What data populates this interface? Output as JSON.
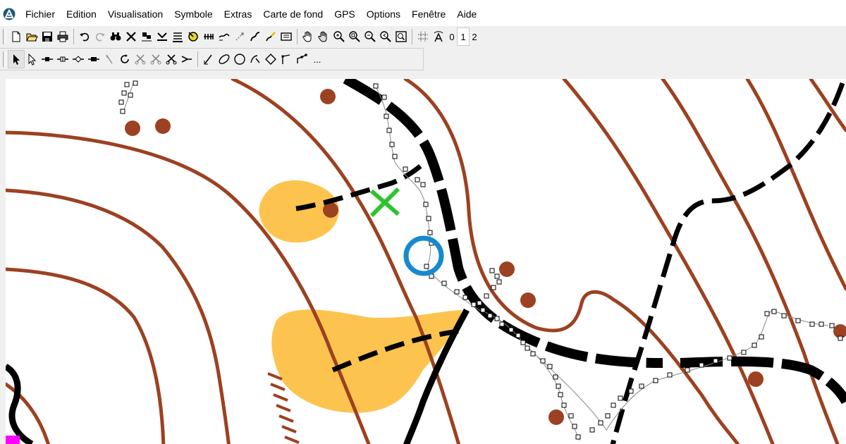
{
  "menu": {
    "items": [
      "Fichier",
      "Edition",
      "Visualisation",
      "Symbole",
      "Extras",
      "Carte de fond",
      "GPS",
      "Options",
      "Fenêtre",
      "Aide"
    ]
  },
  "toolbar1": {
    "icons": [
      "new-file-icon",
      "open-folder-icon",
      "save-icon",
      "print-icon",
      "undo-icon",
      "redo-icon",
      "binoculars-icon",
      "delete-cross-icon",
      "align-icon",
      "align-bottom-icon",
      "align-text-icon",
      "tag-icon",
      "measure-icon",
      "path-icon",
      "gps-icon",
      "curve-icon",
      "draw-icon",
      "frame-icon",
      "pan-hand-icon",
      "pan-hand-alt-icon",
      "zoom-in-icon",
      "zoom-window-icon",
      "zoom-out-icon",
      "zoom-previous-icon",
      "zoom-fit-icon",
      "grid-icon",
      "text-icon"
    ],
    "num_buttons": [
      "0",
      "1",
      "2"
    ],
    "active_num": "1"
  },
  "toolbar2": {
    "icons": [
      "select-arrow-icon",
      "select-outline-icon",
      "add-node-icon",
      "insert-node-icon",
      "move-node-icon",
      "remove-node-icon",
      "pointer-icon",
      "rotate-icon",
      "cut-scissors-icon",
      "cut-area-icon",
      "scissors-icon",
      "join-icon",
      "line-tool-icon",
      "ellipse-tool-icon",
      "circle-tool-icon",
      "curve-tool-icon",
      "rectangle-tool-icon",
      "straight-line-icon",
      "polyline-icon"
    ],
    "more_label": "...",
    "active": "select-arrow-icon"
  },
  "colors": {
    "contour": "#9c4121",
    "knoll": "#9c4121",
    "path": "#000000",
    "open_land": "#fcc44f",
    "start_cross": "#2fc42f",
    "control_circle": "#1789cf",
    "magenta": "#ff00ff"
  }
}
